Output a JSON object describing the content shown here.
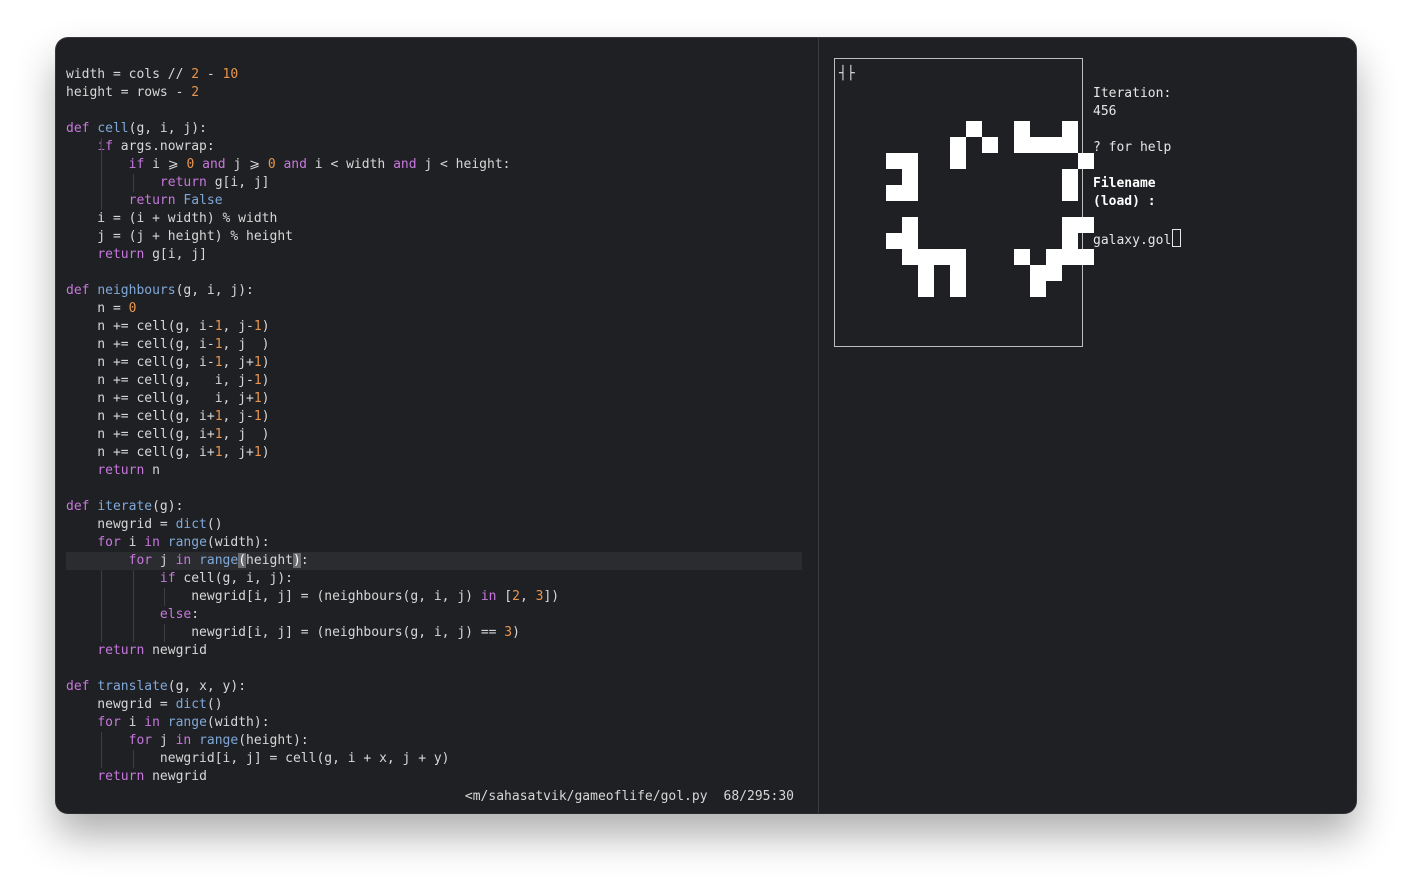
{
  "editor": {
    "lines": [
      {
        "parts": [
          [
            "",
            "width = cols // "
          ],
          [
            "num",
            "2"
          ],
          [
            "",
            " - "
          ],
          [
            "num",
            "10"
          ]
        ]
      },
      {
        "parts": [
          [
            "",
            "height = rows - "
          ],
          [
            "num",
            "2"
          ]
        ]
      },
      {
        "parts": []
      },
      {
        "parts": [
          [
            "kw",
            "def "
          ],
          [
            "fn",
            "cell"
          ],
          [
            "",
            "(g, i, j):"
          ]
        ]
      },
      {
        "parts": [
          [
            "",
            "    "
          ],
          [
            "kw",
            "if"
          ],
          [
            "",
            " args.nowrap:"
          ]
        ],
        "guides": [
          1
        ]
      },
      {
        "parts": [
          [
            "",
            "        "
          ],
          [
            "kw",
            "if"
          ],
          [
            "",
            " i ⩾ "
          ],
          [
            "num",
            "0"
          ],
          [
            "",
            " "
          ],
          [
            "kw",
            "and"
          ],
          [
            "",
            " j ⩾ "
          ],
          [
            "num",
            "0"
          ],
          [
            "",
            " "
          ],
          [
            "kw",
            "and"
          ],
          [
            "",
            " i < width "
          ],
          [
            "kw",
            "and"
          ],
          [
            "",
            " j < height:"
          ]
        ],
        "guides": [
          1
        ]
      },
      {
        "parts": [
          [
            "",
            "            "
          ],
          [
            "kw",
            "return"
          ],
          [
            "",
            " g[i, j]"
          ]
        ],
        "guides": [
          1,
          2
        ]
      },
      {
        "parts": [
          [
            "",
            "        "
          ],
          [
            "kw",
            "return"
          ],
          [
            "",
            " "
          ],
          [
            "fn",
            "False"
          ]
        ],
        "guides": [
          1
        ]
      },
      {
        "parts": [
          [
            "",
            "    i = (i + width) % width"
          ]
        ]
      },
      {
        "parts": [
          [
            "",
            "    j = (j + height) % height"
          ]
        ]
      },
      {
        "parts": [
          [
            "",
            "    "
          ],
          [
            "kw",
            "return"
          ],
          [
            "",
            " g[i, j]"
          ]
        ]
      },
      {
        "parts": []
      },
      {
        "parts": [
          [
            "kw",
            "def "
          ],
          [
            "fn",
            "neighbours"
          ],
          [
            "",
            "(g, i, j):"
          ]
        ]
      },
      {
        "parts": [
          [
            "",
            "    n = "
          ],
          [
            "num",
            "0"
          ]
        ]
      },
      {
        "parts": [
          [
            "",
            "    n += cell(g, i-"
          ],
          [
            "num",
            "1"
          ],
          [
            "",
            ", j-"
          ],
          [
            "num",
            "1"
          ],
          [
            "",
            ")"
          ]
        ]
      },
      {
        "parts": [
          [
            "",
            "    n += cell(g, i-"
          ],
          [
            "num",
            "1"
          ],
          [
            "",
            ", j  )"
          ]
        ]
      },
      {
        "parts": [
          [
            "",
            "    n += cell(g, i-"
          ],
          [
            "num",
            "1"
          ],
          [
            "",
            ", j+"
          ],
          [
            "num",
            "1"
          ],
          [
            "",
            ")"
          ]
        ]
      },
      {
        "parts": [
          [
            "",
            "    n += cell(g,   i, j-"
          ],
          [
            "num",
            "1"
          ],
          [
            "",
            ")"
          ]
        ]
      },
      {
        "parts": [
          [
            "",
            "    n += cell(g,   i, j+"
          ],
          [
            "num",
            "1"
          ],
          [
            "",
            ")"
          ]
        ]
      },
      {
        "parts": [
          [
            "",
            "    n += cell(g, i+"
          ],
          [
            "num",
            "1"
          ],
          [
            "",
            ", j-"
          ],
          [
            "num",
            "1"
          ],
          [
            "",
            ")"
          ]
        ]
      },
      {
        "parts": [
          [
            "",
            "    n += cell(g, i+"
          ],
          [
            "num",
            "1"
          ],
          [
            "",
            ", j  )"
          ]
        ]
      },
      {
        "parts": [
          [
            "",
            "    n += cell(g, i+"
          ],
          [
            "num",
            "1"
          ],
          [
            "",
            ", j+"
          ],
          [
            "num",
            "1"
          ],
          [
            "",
            ")"
          ]
        ]
      },
      {
        "parts": [
          [
            "",
            "    "
          ],
          [
            "kw",
            "return"
          ],
          [
            "",
            " n"
          ]
        ]
      },
      {
        "parts": []
      },
      {
        "parts": [
          [
            "kw",
            "def "
          ],
          [
            "fn",
            "iterate"
          ],
          [
            "",
            "(g):"
          ]
        ]
      },
      {
        "parts": [
          [
            "",
            "    newgrid = "
          ],
          [
            "fn",
            "dict"
          ],
          [
            "",
            "()"
          ]
        ]
      },
      {
        "parts": [
          [
            "",
            "    "
          ],
          [
            "kw",
            "for"
          ],
          [
            "",
            " i "
          ],
          [
            "kw",
            "in"
          ],
          [
            "",
            " "
          ],
          [
            "fn",
            "range"
          ],
          [
            "",
            "(width):"
          ]
        ]
      },
      {
        "parts": [
          [
            "",
            "        "
          ],
          [
            "kw",
            "for"
          ],
          [
            "",
            " j "
          ],
          [
            "kw",
            "in"
          ],
          [
            "",
            " "
          ],
          [
            "fn",
            "range"
          ],
          [
            "cursor",
            "("
          ],
          [
            "",
            "height"
          ],
          [
            "cursor",
            ")"
          ],
          [
            "",
            ":"
          ]
        ],
        "current": true
      },
      {
        "parts": [
          [
            "",
            "            "
          ],
          [
            "kw",
            "if"
          ],
          [
            "",
            " cell(g, i, j):"
          ]
        ],
        "guides": [
          1,
          2
        ]
      },
      {
        "parts": [
          [
            "",
            "                newgrid[i, j] = (neighbours(g, i, j) "
          ],
          [
            "kw",
            "in"
          ],
          [
            "",
            " ["
          ],
          [
            "num",
            "2"
          ],
          [
            "",
            ", "
          ],
          [
            "num",
            "3"
          ],
          [
            "",
            "])"
          ]
        ],
        "guides": [
          1,
          2,
          3
        ]
      },
      {
        "parts": [
          [
            "",
            "            "
          ],
          [
            "kw",
            "else"
          ],
          [
            "",
            ":"
          ]
        ],
        "guides": [
          1,
          2
        ]
      },
      {
        "parts": [
          [
            "",
            "                newgrid[i, j] = (neighbours(g, i, j) == "
          ],
          [
            "num",
            "3"
          ],
          [
            "",
            ")"
          ]
        ],
        "guides": [
          1,
          2,
          3
        ]
      },
      {
        "parts": [
          [
            "",
            "    "
          ],
          [
            "kw",
            "return"
          ],
          [
            "",
            " newgrid"
          ]
        ]
      },
      {
        "parts": []
      },
      {
        "parts": [
          [
            "kw",
            "def "
          ],
          [
            "fn",
            "translate"
          ],
          [
            "",
            "(g, x, y):"
          ]
        ]
      },
      {
        "parts": [
          [
            "",
            "    newgrid = "
          ],
          [
            "fn",
            "dict"
          ],
          [
            "",
            "()"
          ]
        ]
      },
      {
        "parts": [
          [
            "",
            "    "
          ],
          [
            "kw",
            "for"
          ],
          [
            "",
            " i "
          ],
          [
            "kw",
            "in"
          ],
          [
            "",
            " "
          ],
          [
            "fn",
            "range"
          ],
          [
            "",
            "(width):"
          ]
        ]
      },
      {
        "parts": [
          [
            "",
            "        "
          ],
          [
            "kw",
            "for"
          ],
          [
            "",
            " j "
          ],
          [
            "kw",
            "in"
          ],
          [
            "",
            " "
          ],
          [
            "fn",
            "range"
          ],
          [
            "",
            "(height):"
          ]
        ],
        "guides": [
          1
        ]
      },
      {
        "parts": [
          [
            "",
            "            newgrid[i, j] = cell(g, i + x, j + y)"
          ]
        ],
        "guides": [
          1,
          2
        ]
      },
      {
        "parts": [
          [
            "",
            "    "
          ],
          [
            "kw",
            "return"
          ],
          [
            "",
            " newgrid"
          ]
        ]
      }
    ],
    "status": {
      "path": "<m/sahasatvik/gameoflife/gol.py",
      "position": "68/295:30"
    }
  },
  "simulation": {
    "corner_marker": "┤├",
    "live_cells": [
      [
        5,
        0
      ],
      [
        4,
        1
      ],
      [
        6,
        1
      ],
      [
        0,
        2
      ],
      [
        1,
        2
      ],
      [
        4,
        2
      ],
      [
        1,
        3
      ],
      [
        0,
        4
      ],
      [
        1,
        4
      ],
      [
        8,
        0
      ],
      [
        11,
        0
      ],
      [
        8,
        1
      ],
      [
        9,
        1
      ],
      [
        10,
        1
      ],
      [
        11,
        1
      ],
      [
        12,
        2
      ],
      [
        11,
        3
      ],
      [
        11,
        4
      ],
      [
        1,
        6
      ],
      [
        0,
        7
      ],
      [
        1,
        7
      ],
      [
        1,
        8
      ],
      [
        2,
        8
      ],
      [
        3,
        8
      ],
      [
        4,
        8
      ],
      [
        2,
        9
      ],
      [
        4,
        9
      ],
      [
        2,
        10
      ],
      [
        4,
        10
      ],
      [
        11,
        6
      ],
      [
        12,
        6
      ],
      [
        11,
        7
      ],
      [
        10,
        8
      ],
      [
        11,
        8
      ],
      [
        12,
        8
      ],
      [
        8,
        8
      ],
      [
        9,
        9
      ],
      [
        10,
        9
      ],
      [
        9,
        10
      ]
    ]
  },
  "info": {
    "iteration_label": "Iteration:",
    "iteration_value": "456",
    "help": "? for help",
    "filename_label": "Filename",
    "filename_mode": "(load) :",
    "filename_input": "galaxy.gol"
  }
}
